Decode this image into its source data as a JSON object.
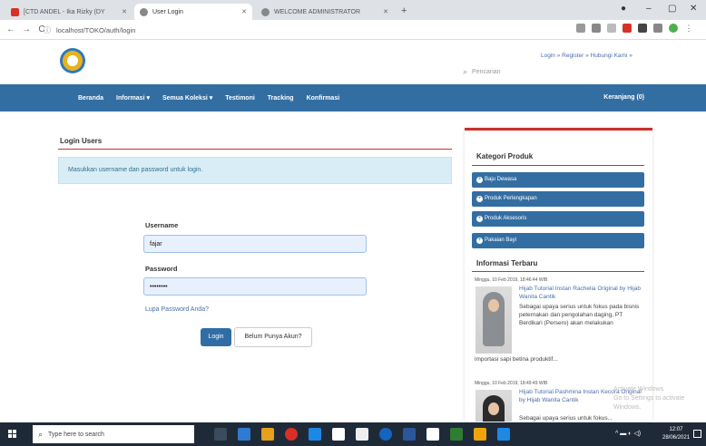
{
  "browser": {
    "tabs": [
      {
        "title": "[CTD ANDEL - Ika Rizky (DY",
        "color": "#d93025",
        "active": false,
        "audio": true
      },
      {
        "title": "User Login",
        "color": "#5f6368",
        "active": true
      },
      {
        "title": "WELCOME ADMINISTRATOR",
        "color": "#5f6368",
        "active": false
      }
    ],
    "new_tab": "+",
    "url": "localhost/TOKO/auth/login",
    "window_controls": {
      "minimize": "–",
      "maximize": "▢",
      "close": "✕"
    }
  },
  "site": {
    "top_links": "Login » Register » Hubungi Kami »",
    "search_placeholder": "Pencarian",
    "nav": [
      "Beranda",
      "Informasi ▾",
      "Semua Koleksi ▾",
      "Testimoni",
      "Tracking",
      "Konfirmasi"
    ],
    "cart": "Keranjang (0)"
  },
  "login": {
    "title": "Login Users",
    "alert": "Masukkan username dan password untuk login.",
    "username_label": "Username",
    "username_value": "fajar",
    "password_label": "Password",
    "password_value": "••••••••",
    "forgot": "Lupa Password Anda?",
    "login_btn": "Login",
    "register_btn": "Belum Punya Akun?"
  },
  "sidebar": {
    "category_title": "Kategori Produk",
    "categories": [
      "Baju Dewasa",
      "Produk Perlengkapan",
      "Produk Aksesoris",
      "Pakaian Bayi"
    ],
    "info_title": "Informasi Terbaru",
    "posts": [
      {
        "meta": "Minggu, 10 Feb 2019, 18:46:44 WIB",
        "title": "Hijab Tutorial Instan Rachelia Original by Hijab Wanita Cantik",
        "excerpt": "Sebagai upaya serius untuk fokus pada bisnis peternakan dan pengolahan daging, PT Berdikari (Persero) akan melakukan",
        "excerpt_tail": "importasi sapi betina produktif..."
      },
      {
        "meta": "Minggu, 10 Feb 2019, 18:49:49 WIB",
        "title": "Hijab Tutorial Pashmina Instan Kecora Original by Hijab Wanita Cantik",
        "excerpt": "Sebagai upaya serius untuk fokus..."
      }
    ]
  },
  "watermark": {
    "line1": "Activate Windows",
    "line2": "Go to Settings to activate Windows."
  },
  "taskbar": {
    "search_placeholder": "Type here to search",
    "time": "12:07",
    "date": "28/06/2021"
  }
}
